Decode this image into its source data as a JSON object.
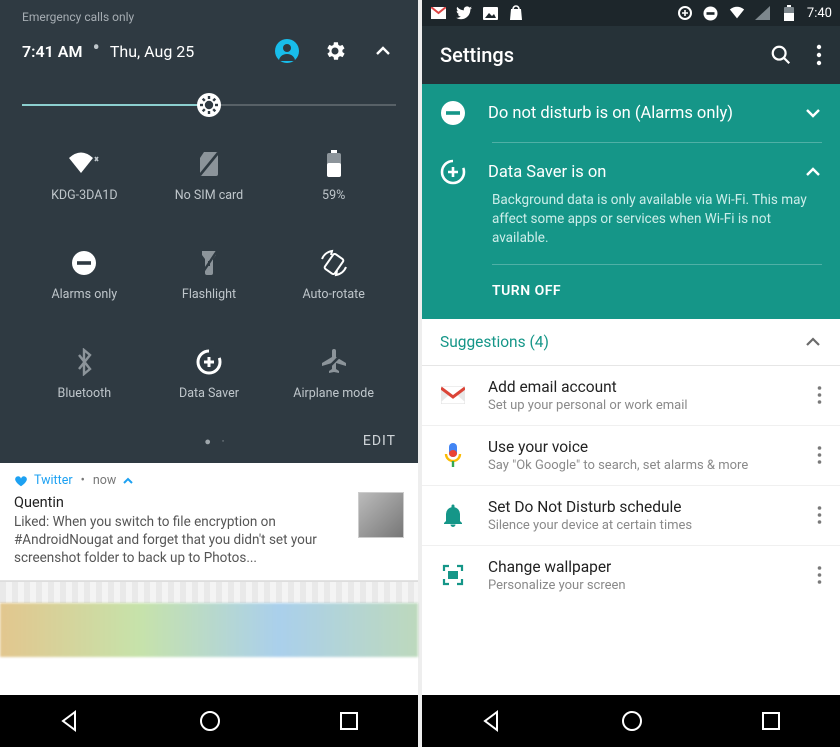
{
  "left": {
    "emergency": "Emergency calls only",
    "time": "7:41 AM",
    "date": "Thu, Aug 25",
    "brightness_percent": 50,
    "tiles": [
      {
        "label": "KDG-3DA1D",
        "icon": "wifi"
      },
      {
        "label": "No SIM card",
        "icon": "no-sim"
      },
      {
        "label": "59%",
        "icon": "battery"
      },
      {
        "label": "Alarms only",
        "icon": "dnd"
      },
      {
        "label": "Flashlight",
        "icon": "flashlight"
      },
      {
        "label": "Auto-rotate",
        "icon": "rotate"
      },
      {
        "label": "Bluetooth",
        "icon": "bluetooth"
      },
      {
        "label": "Data Saver",
        "icon": "datasaver"
      },
      {
        "label": "Airplane mode",
        "icon": "airplane"
      }
    ],
    "pager": "● ·",
    "edit": "EDIT",
    "notif": {
      "app": "Twitter",
      "when": "now",
      "sender": "Quentin",
      "body": "Liked: When you switch to file encryption on #AndroidNougat and forget that you didn't set your screenshot folder to back up to Photos..."
    }
  },
  "right": {
    "status_time": "7:40",
    "settings_title": "Settings",
    "cards": {
      "dnd": {
        "label": "Do not disturb is on (Alarms only)"
      },
      "datasaver": {
        "label": "Data Saver is on",
        "desc": "Background data is only available via Wi-Fi. This may affect some apps or services when Wi-Fi is not available.",
        "action": "TURN OFF"
      }
    },
    "suggestions_label": "Suggestions (4)",
    "suggestions": [
      {
        "title": "Add email account",
        "sub": "Set up your personal or work email",
        "icon": "gmail"
      },
      {
        "title": "Use your voice",
        "sub": "Say \"Ok Google\" to search, set alarms & more",
        "icon": "voice"
      },
      {
        "title": "Set Do Not Disturb schedule",
        "sub": "Silence your device at certain times",
        "icon": "bell"
      },
      {
        "title": "Change wallpaper",
        "sub": "Personalize your screen",
        "icon": "wallpaper"
      }
    ]
  }
}
